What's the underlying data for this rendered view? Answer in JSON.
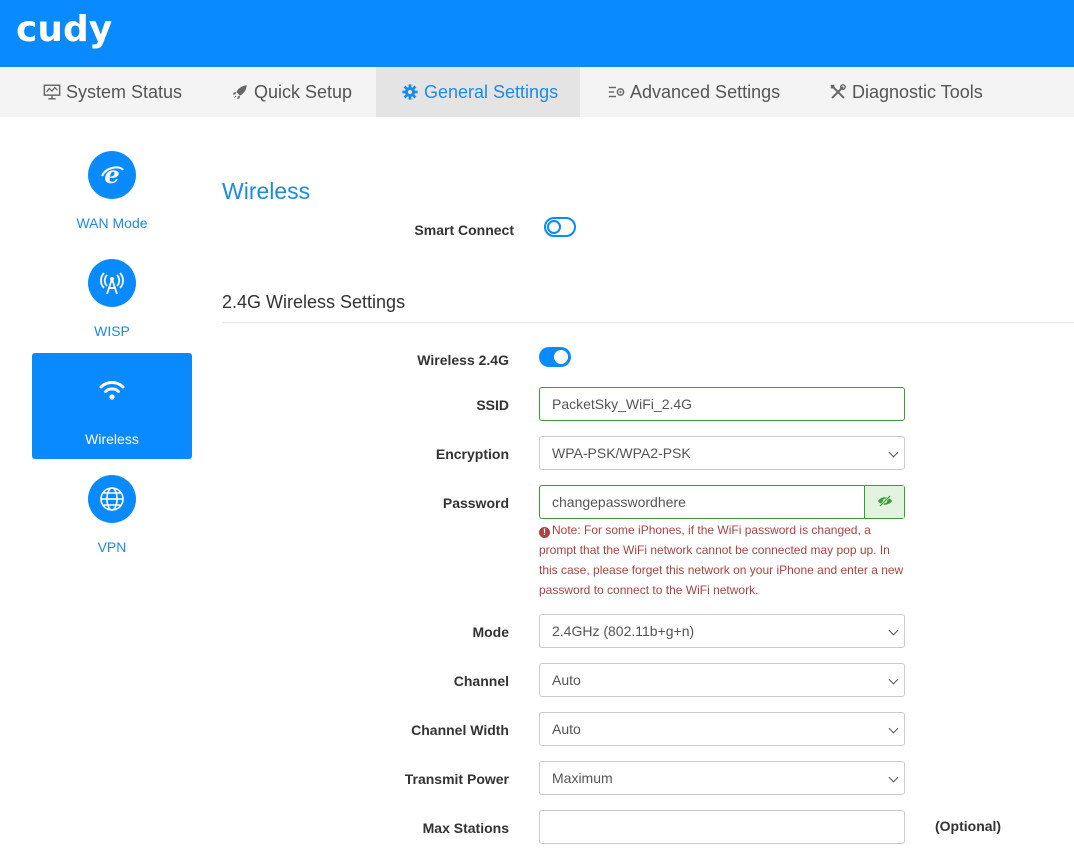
{
  "header": {
    "logo": "cudy",
    "brand_color": "#0a8aff"
  },
  "nav": {
    "tabs": [
      {
        "label": "System Status",
        "icon": "monitor-icon"
      },
      {
        "label": "Quick Setup",
        "icon": "rocket-icon"
      },
      {
        "label": "General Settings",
        "icon": "gear-icon",
        "active": true
      },
      {
        "label": "Advanced Settings",
        "icon": "sliders-icon"
      },
      {
        "label": "Diagnostic Tools",
        "icon": "tools-icon"
      }
    ]
  },
  "sidebar": {
    "items": [
      {
        "label": "WAN Mode",
        "icon": "globe-e-icon"
      },
      {
        "label": "WISP",
        "icon": "antenna-icon"
      },
      {
        "label": "Wireless",
        "icon": "wifi-icon",
        "active": true
      },
      {
        "label": "VPN",
        "icon": "vpn-globe-icon"
      }
    ]
  },
  "main": {
    "title": "Wireless",
    "smart_connect": {
      "label": "Smart Connect",
      "enabled": false
    },
    "section_title": "2.4G Wireless Settings",
    "fields": {
      "wireless": {
        "label": "Wireless 2.4G",
        "enabled": true
      },
      "ssid": {
        "label": "SSID",
        "value": "PacketSky_WiFi_2.4G"
      },
      "encryption": {
        "label": "Encryption",
        "value": "WPA-PSK/WPA2-PSK"
      },
      "password": {
        "label": "Password",
        "value": "changepasswordhere"
      },
      "note": "Note: For some iPhones, if the WiFi password is changed, a prompt that the WiFi network cannot be connected may pop up. In this case, please forget this network on your iPhone and enter a new password to connect to the WiFi network.",
      "mode": {
        "label": "Mode",
        "value": "2.4GHz (802.11b+g+n)"
      },
      "channel": {
        "label": "Channel",
        "value": "Auto"
      },
      "channel_width": {
        "label": "Channel Width",
        "value": "Auto"
      },
      "transmit_power": {
        "label": "Transmit Power",
        "value": "Maximum"
      },
      "max_stations": {
        "label": "Max Stations",
        "value": "",
        "hint": "(Optional)"
      }
    }
  }
}
